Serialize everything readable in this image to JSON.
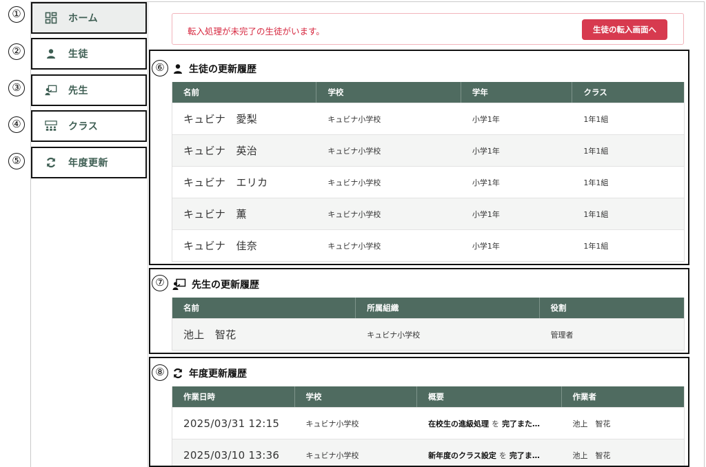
{
  "markers": [
    "①",
    "②",
    "③",
    "④",
    "⑤",
    "⑥",
    "⑦",
    "⑧"
  ],
  "sidebar": {
    "items": [
      {
        "label": "ホーム",
        "icon": "dashboard-icon"
      },
      {
        "label": "生徒",
        "icon": "person-icon"
      },
      {
        "label": "先生",
        "icon": "teacher-icon"
      },
      {
        "label": "クラス",
        "icon": "class-icon"
      },
      {
        "label": "年度更新",
        "icon": "refresh-icon"
      }
    ]
  },
  "alert": {
    "message": "転入処理が未完了の生徒がいます。",
    "button": "生徒の転入画面へ"
  },
  "students": {
    "title": "生徒の更新履歴",
    "columns": [
      "名前",
      "学校",
      "学年",
      "クラス"
    ],
    "rows": [
      [
        "キュビナ　愛梨",
        "キュビナ小学校",
        "小学1年",
        "1年1組"
      ],
      [
        "キュビナ　英治",
        "キュビナ小学校",
        "小学1年",
        "1年1組"
      ],
      [
        "キュビナ　エリカ",
        "キュビナ小学校",
        "小学1年",
        "1年1組"
      ],
      [
        "キュビナ　薫",
        "キュビナ小学校",
        "小学1年",
        "1年1組"
      ],
      [
        "キュビナ　佳奈",
        "キュビナ小学校",
        "小学1年",
        "1年1組"
      ]
    ]
  },
  "teachers": {
    "title": "先生の更新履歴",
    "columns": [
      "名前",
      "所属組織",
      "役割"
    ],
    "rows": [
      [
        "池上　智花",
        "キュビナ小学校",
        "管理者"
      ]
    ]
  },
  "annual": {
    "title": "年度更新履歴",
    "columns": [
      "作業日時",
      "学校",
      "概要",
      "作業者"
    ],
    "rows": [
      {
        "datetime": "2025/03/31 12:15",
        "school": "キュビナ小学校",
        "summary_main": "在校生の進級処理",
        "summary_wo": "を",
        "summary_rest": "完了また…",
        "operator": "池上　智花"
      },
      {
        "datetime": "2025/03/10 13:36",
        "school": "キュビナ小学校",
        "summary_main": "新年度のクラス設定",
        "summary_wo": "を",
        "summary_rest": "完了ま…",
        "operator": "池上　智花"
      }
    ]
  },
  "colors": {
    "accent": "#4f6b60",
    "nav_text": "#3e5e53",
    "alert_text": "#d6273f",
    "alert_button": "#d73a4f"
  }
}
